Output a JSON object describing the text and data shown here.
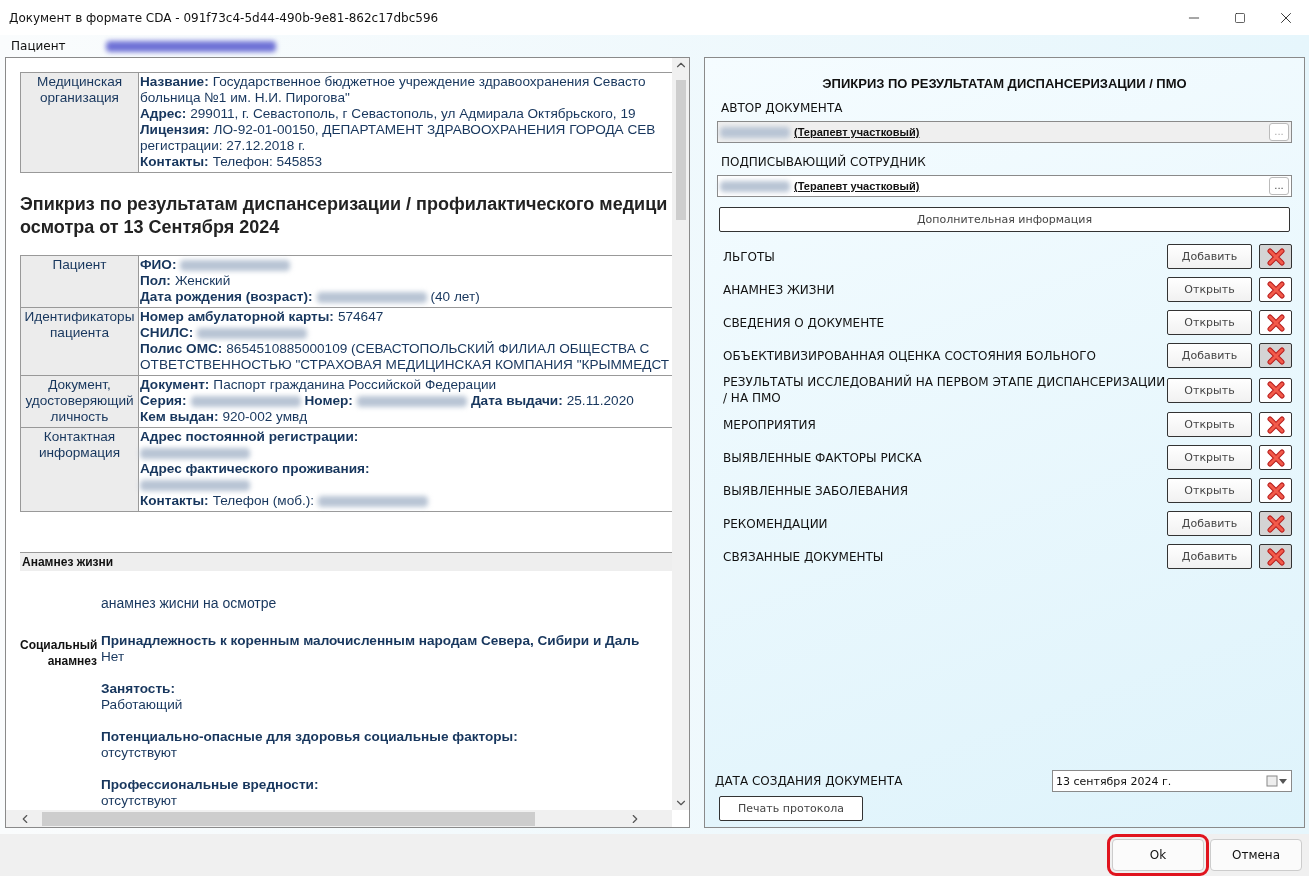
{
  "window": {
    "title": "Документ в формате CDA - 091f73c4-5d44-490b-9e81-862c17dbc596"
  },
  "patient_bar": {
    "label": "Пациент",
    "name": {
      "kind": "redacted"
    }
  },
  "document": {
    "org_table": [
      {
        "label": "Медицинская организация",
        "lines": [
          [
            {
              "kind": "key",
              "text": "Название:"
            },
            {
              "kind": "text",
              "text": "Государственное бюджетное учреждение здравоохранения Севасто"
            }
          ],
          [
            {
              "kind": "text",
              "text": "больница №1 им. Н.И. Пирогова\""
            }
          ],
          [
            {
              "kind": "key",
              "text": "Адрес:"
            },
            {
              "kind": "text",
              "text": "299011, г. Севастополь, г Севастополь, ул Адмирала Октябрьского, 19"
            }
          ],
          [
            {
              "kind": "key",
              "text": "Лицензия:"
            },
            {
              "kind": "text",
              "text": "ЛО-92-01-00150, ДЕПАРТАМЕНТ ЗДРАВООХРАНЕНИЯ ГОРОДА СЕВ"
            }
          ],
          [
            {
              "kind": "text",
              "text": "регистрации: 27.12.2018 г."
            }
          ],
          [
            {
              "kind": "key",
              "text": "Контакты:"
            },
            {
              "kind": "text",
              "text": "Телефон: 545853"
            }
          ]
        ]
      }
    ],
    "heading": [
      "Эпикриз по результатам диспансеризации / профилактического медици",
      "осмотра от 13 Сентября 2024"
    ],
    "patient_table": [
      {
        "label": "Пациент",
        "lines": [
          [
            {
              "kind": "key",
              "text": "ФИО:"
            },
            {
              "kind": "redacted"
            }
          ],
          [
            {
              "kind": "key",
              "text": "Пол:"
            },
            {
              "kind": "text",
              "text": "Женский"
            }
          ],
          [
            {
              "kind": "key",
              "text": "Дата рождения (возраст):"
            },
            {
              "kind": "redacted"
            },
            {
              "kind": "text",
              "text": "(40 лет)"
            }
          ]
        ]
      },
      {
        "label": "Идентификаторы пациента",
        "lines": [
          [
            {
              "kind": "key",
              "text": "Номер амбулаторной карты:"
            },
            {
              "kind": "text",
              "text": "574647"
            }
          ],
          [
            {
              "kind": "key",
              "text": "СНИЛС:"
            },
            {
              "kind": "redacted"
            }
          ],
          [
            {
              "kind": "key",
              "text": "Полис ОМС:"
            },
            {
              "kind": "text",
              "text": "8654510885000109 (СЕВАСТОПОЛЬСКИЙ ФИЛИАЛ ОБЩЕСТВА С"
            }
          ],
          [
            {
              "kind": "text",
              "text": "ОТВЕТСТВЕННОСТЬЮ \"СТРАХОВАЯ МЕДИЦИНСКАЯ КОМПАНИЯ \"КРЫММЕДСТ"
            }
          ]
        ]
      },
      {
        "label": "Документ, удостоверяющий личность",
        "lines": [
          [
            {
              "kind": "key",
              "text": "Документ:"
            },
            {
              "kind": "text",
              "text": "Паспорт гражданина Российской Федерации"
            }
          ],
          [
            {
              "kind": "key",
              "text": "Серия:"
            },
            {
              "kind": "redacted"
            },
            {
              "kind": "key",
              "text": "Номер:"
            },
            {
              "kind": "redacted"
            },
            {
              "kind": "key",
              "text": "Дата выдачи:"
            },
            {
              "kind": "text",
              "text": "25.11.2020"
            }
          ],
          [
            {
              "kind": "key",
              "text": "Кем выдан:"
            },
            {
              "kind": "text",
              "text": "920-002 умвд"
            }
          ]
        ]
      },
      {
        "label": "Контактная информация",
        "lines": [
          [
            {
              "kind": "key",
              "text": "Адрес постоянной регистрации:"
            }
          ],
          [
            {
              "kind": "redacted"
            }
          ],
          [
            {
              "kind": "key",
              "text": "Адрес фактического проживания:"
            }
          ],
          [
            {
              "kind": "redacted"
            }
          ],
          [
            {
              "kind": "key",
              "text": "Контакты:"
            },
            {
              "kind": "text",
              "text": "Телефон (моб.):"
            },
            {
              "kind": "redacted"
            }
          ]
        ]
      }
    ],
    "section_title": "Анамнез жизни",
    "intro": "анамнез жисни на осмотре",
    "social": {
      "label": "Социальный анамнез",
      "items": [
        {
          "title": "Принадлежность к коренным малочисленным народам Севера, Сибири и Даль",
          "value": "Нет"
        },
        {
          "title": "Занятость:",
          "value": "Работающий"
        },
        {
          "title": "Потенциально-опасные для здоровья социальные факторы:",
          "value": "отсутствуют"
        },
        {
          "title": "Профессиональные вредности:",
          "value": "отсутствуют"
        }
      ]
    }
  },
  "panel": {
    "title": "ЭПИКРИЗ ПО РЕЗУЛЬТАТАМ ДИСПАНСЕРИЗАЦИИ / ПМО",
    "author": {
      "label": "АВТОР ДОКУМЕНТА",
      "role": "(Терапевт участковый)",
      "browse": "...",
      "disabled": true
    },
    "signer": {
      "label": "ПОДПИСЫВАЮЩИЙ СОТРУДНИК",
      "role": "(Терапевт участковый)",
      "browse": "...",
      "disabled": false
    },
    "more_button": "Дополнительная информация",
    "sections": [
      {
        "label": "ЛЬГОТЫ",
        "action": "Добавить",
        "delete_disabled": true
      },
      {
        "label": "АНАМНЕЗ ЖИЗНИ",
        "action": "Открыть",
        "delete_disabled": false
      },
      {
        "label": "СВЕДЕНИЯ О ДОКУМЕНТЕ",
        "action": "Открыть",
        "delete_disabled": false
      },
      {
        "label": "ОБЪЕКТИВИЗИРОВАННАЯ ОЦЕНКА СОСТОЯНИЯ БОЛЬНОГО",
        "action": "Добавить",
        "delete_disabled": true
      },
      {
        "label": "РЕЗУЛЬТАТЫ ИССЛЕДОВАНИЙ НА ПЕРВОМ ЭТАПЕ ДИСПАНСЕРИЗАЦИИ / НА ПМО",
        "action": "Открыть",
        "delete_disabled": false
      },
      {
        "label": "МЕРОПРИЯТИЯ",
        "action": "Открыть",
        "delete_disabled": false
      },
      {
        "label": "ВЫЯВЛЕННЫЕ ФАКТОРЫ РИСКА",
        "action": "Открыть",
        "delete_disabled": false
      },
      {
        "label": "ВЫЯВЛЕННЫЕ ЗАБОЛЕВАНИЯ",
        "action": "Открыть",
        "delete_disabled": false
      },
      {
        "label": "РЕКОМЕНДАЦИИ",
        "action": "Добавить",
        "delete_disabled": true
      },
      {
        "label": "СВЯЗАННЫЕ ДОКУМЕНТЫ",
        "action": "Добавить",
        "delete_disabled": true
      }
    ],
    "date_label": "ДАТА СОЗДАНИЯ ДОКУМЕНТА",
    "date_value": "13 сентября 2024 г.",
    "print_button": "Печать протокола"
  },
  "footer": {
    "buttons": [
      {
        "label": "Ok",
        "highlighted": true
      },
      {
        "label": "Отмена",
        "highlighted": false
      }
    ]
  }
}
